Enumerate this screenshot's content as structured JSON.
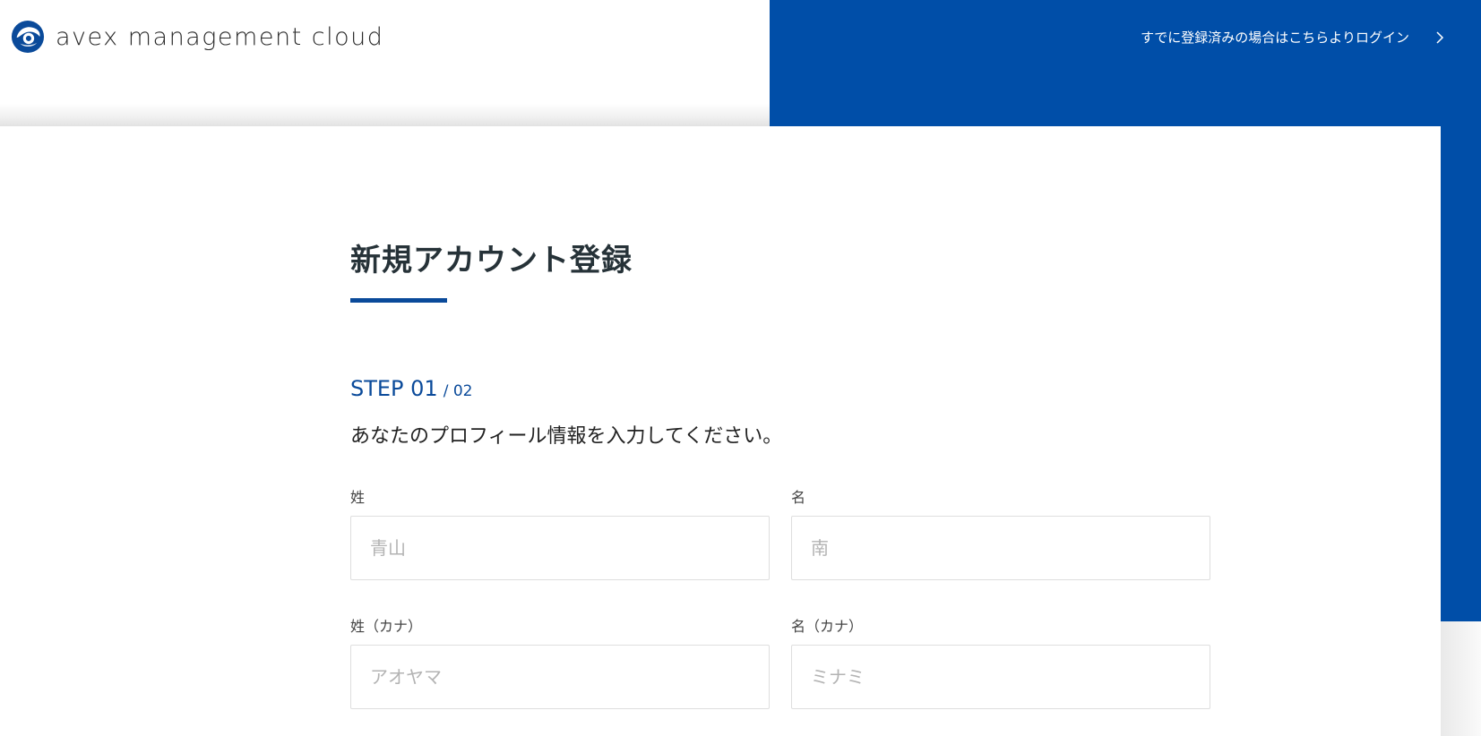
{
  "header": {
    "logo_text": "avex management cloud",
    "login_link": "すでに登録済みの場合はこちらよりログイン"
  },
  "main": {
    "title": "新規アカウント登録",
    "step": {
      "current": "STEP 01",
      "total": "/ 02"
    },
    "instruction": "あなたのプロフィール情報を入力してください。",
    "fields": {
      "last_name": {
        "label": "姓",
        "placeholder": "青山",
        "value": ""
      },
      "first_name": {
        "label": "名",
        "placeholder": "南",
        "value": ""
      },
      "last_name_kana": {
        "label": "姓（カナ）",
        "placeholder": "アオヤマ",
        "value": ""
      },
      "first_name_kana": {
        "label": "名（カナ）",
        "placeholder": "ミナミ",
        "value": ""
      }
    }
  },
  "colors": {
    "brand_blue": "#004ea8",
    "accent_blue": "#0a4a9a",
    "title_text": "#263238",
    "placeholder": "#b3b3b3",
    "input_border": "#dedede"
  },
  "icons": {
    "logo": "avex-logo-mark",
    "login_arrow": "chevron-right-icon"
  }
}
